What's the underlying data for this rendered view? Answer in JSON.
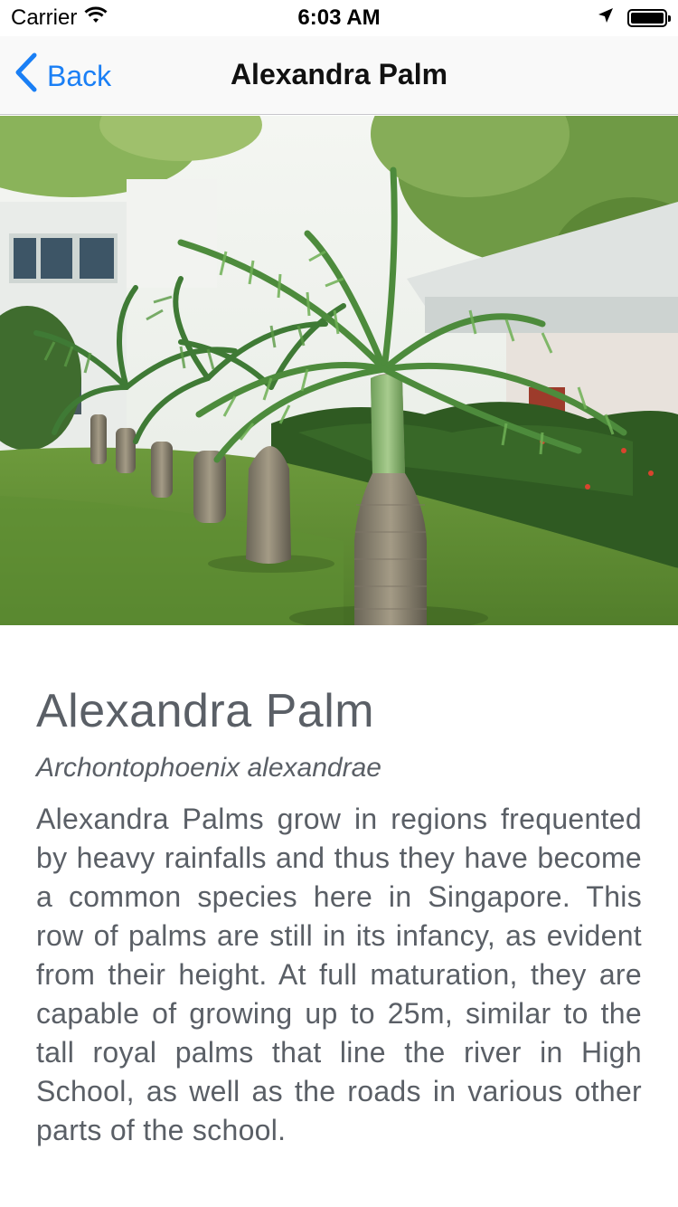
{
  "status_bar": {
    "carrier": "Carrier",
    "time": "6:03 AM",
    "battery_level": 1.0
  },
  "nav": {
    "back_label": "Back",
    "title": "Alexandra Palm"
  },
  "hero": {
    "image_alt": "Alexandra palm trees in a garden"
  },
  "detail": {
    "title": "Alexandra Palm",
    "scientific_name": "Archontophoenix alexandrae",
    "description": "Alexandra Palms grow in regions frequented by heavy rainfalls and thus they have become a common species here in Singapore. This row of palms are still in its infancy, as evident from their height. At full maturation, they are capable of growing up to 25m, similar to the tall royal palms that line the river in High School, as well as the roads in various other parts of the school."
  },
  "colors": {
    "accent": "#1a7ff5",
    "text": "#5a5f66"
  }
}
